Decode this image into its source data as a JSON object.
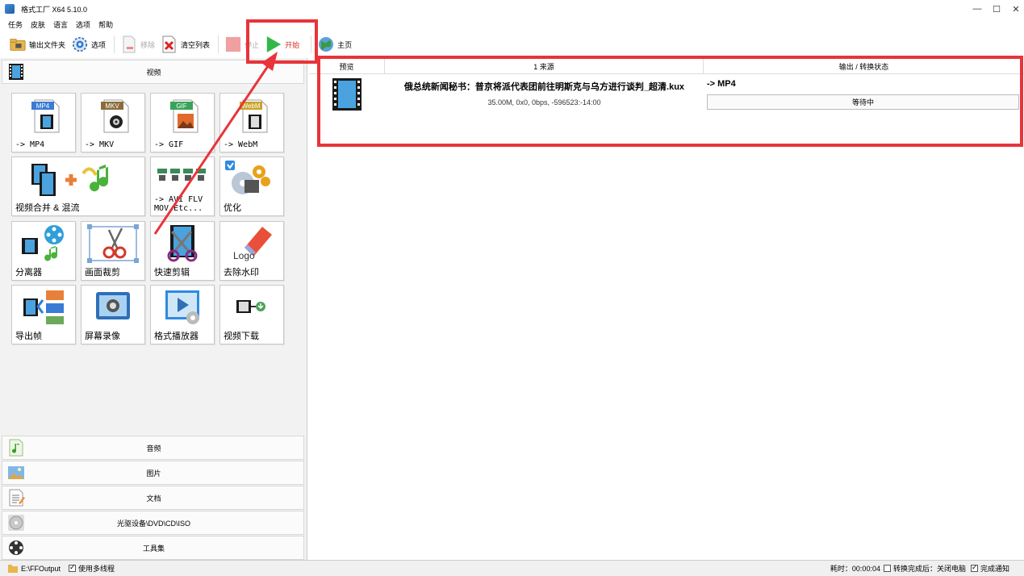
{
  "window": {
    "title": "格式工厂 X64 5.10.0",
    "controls": [
      "—",
      "☐",
      "✕"
    ]
  },
  "menu": [
    "任务",
    "皮肤",
    "语言",
    "选项",
    "帮助"
  ],
  "toolbar": {
    "output_folder": "输出文件夹",
    "options": "选项",
    "remove": "移除",
    "clear_list": "清空列表",
    "stop": "停止",
    "start": "开始",
    "home": "主页"
  },
  "left": {
    "video_label": "视频",
    "tiles": [
      {
        "label": "-> MP4",
        "badge": "MP4",
        "badge_color": "#3a7bd5"
      },
      {
        "label": "-> MKV",
        "badge": "MKV",
        "badge_color": "#8a6d3b"
      },
      {
        "label": "-> GIF",
        "badge": "GIF",
        "badge_color": "#3aa35a"
      },
      {
        "label": "-> WebM",
        "badge": "WebM",
        "badge_color": "#c9a227"
      },
      {
        "label": "视频合并 & 混流"
      },
      {
        "label": "-> AVI FLV\nMOV Etc..."
      },
      {
        "label": "优化"
      },
      {
        "label": "分离器"
      },
      {
        "label": "画面裁剪"
      },
      {
        "label": "快速剪辑"
      },
      {
        "label": "去除水印"
      },
      {
        "label": "导出帧"
      },
      {
        "label": "屏幕录像"
      },
      {
        "label": "格式播放器"
      },
      {
        "label": "视频下载"
      }
    ],
    "logo_text": "Logo",
    "categories": [
      "音频",
      "图片",
      "文档",
      "光驱设备\\DVD\\CD\\ISO",
      "工具集"
    ]
  },
  "table": {
    "headers": [
      "预览",
      "1 来源",
      "输出 / 转换状态"
    ],
    "rows": [
      {
        "filename": "俄总统新闻秘书：普京将派代表团前往明斯克与乌方进行谈判_超清.kux",
        "info": "35.00M, 0x0, 0bps, -596523:-14:00",
        "output": "-> MP4",
        "status": "等待中"
      }
    ]
  },
  "statusbar": {
    "path": "E:\\FFOutput",
    "multithread": "使用多线程",
    "elapsed": "耗时：00:00:04",
    "after_done": "转换完成后：关闭电脑",
    "notify": "完成通知"
  },
  "annotation": {
    "color": "#e8343a"
  }
}
